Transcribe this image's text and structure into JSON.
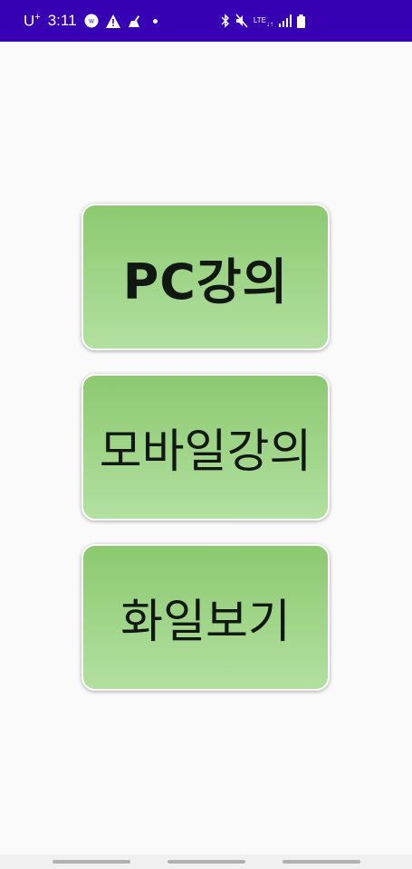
{
  "status_bar": {
    "carrier": "U",
    "carrier_plus": "+",
    "time": "3:11",
    "background": "#3700b3",
    "left_icons": [
      "webex-icon",
      "warning-icon",
      "broom-icon",
      "dot-icon"
    ],
    "right_icons": [
      "bluetooth-icon",
      "mute-icon",
      "lte-icon",
      "signal-icon",
      "battery-icon"
    ],
    "lte_label": "LTE"
  },
  "buttons": [
    {
      "label": "PC강의"
    },
    {
      "label": "모바일강의"
    },
    {
      "label": "화일보기"
    }
  ],
  "colors": {
    "button_top": "#8cc970",
    "button_bottom": "#b2e0a0",
    "button_text": "#111811",
    "page_background": "#fafafa"
  },
  "nav_bar": {
    "items": [
      "recent-apps-handle",
      "home-handle",
      "back-handle"
    ]
  }
}
